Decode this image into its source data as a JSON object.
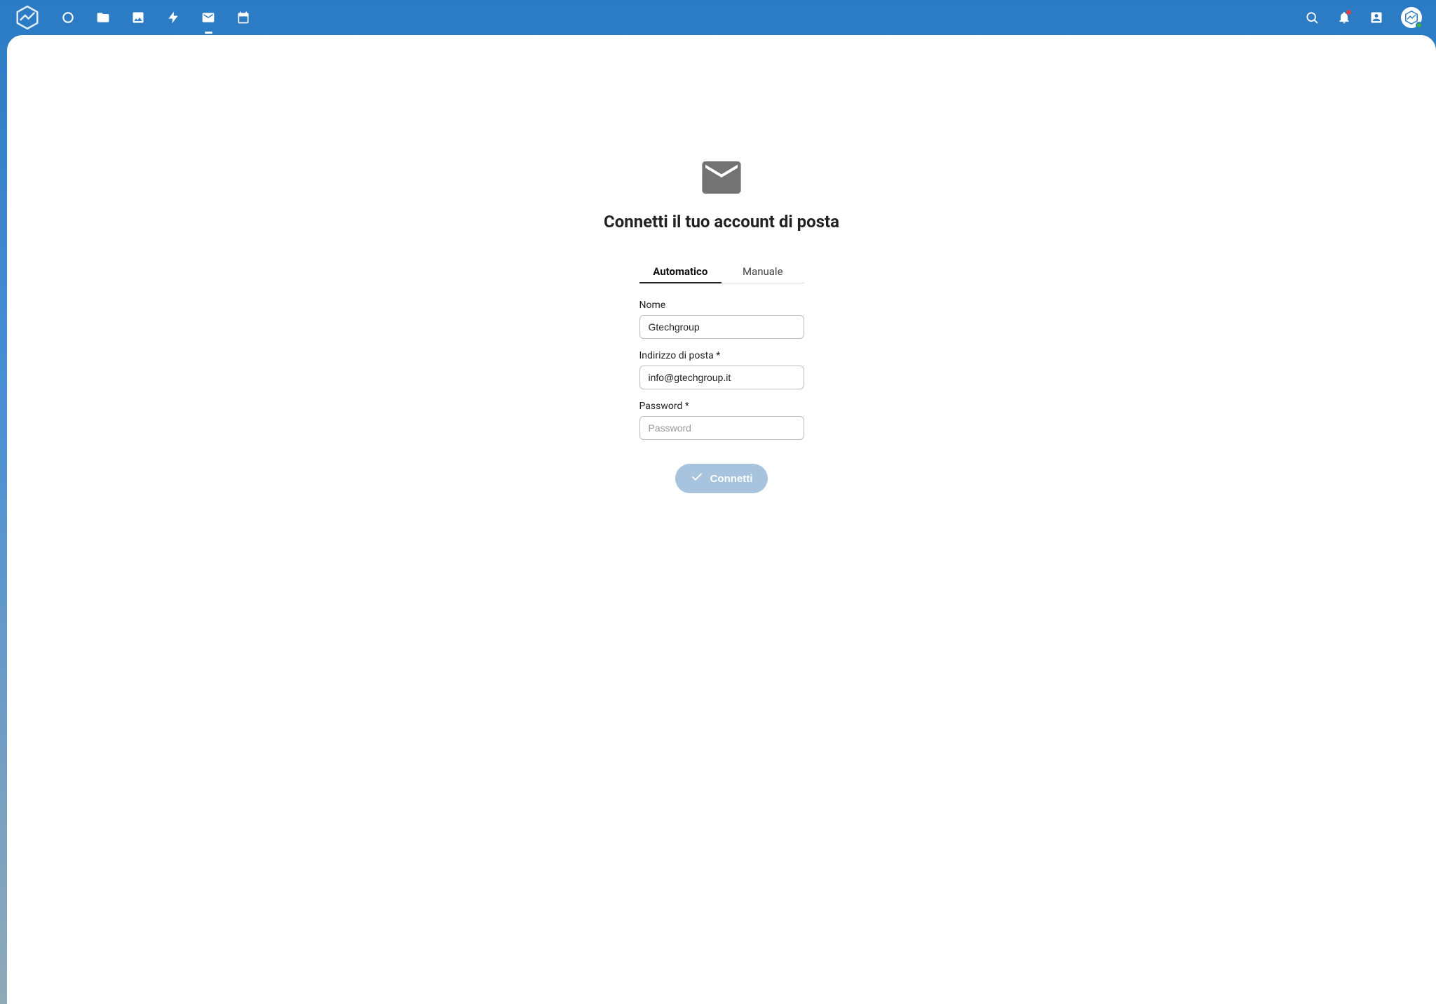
{
  "topbar": {
    "nav_items": [
      {
        "name": "dashboard",
        "icon": "circle"
      },
      {
        "name": "files",
        "icon": "folder"
      },
      {
        "name": "photos",
        "icon": "image"
      },
      {
        "name": "activity",
        "icon": "bolt"
      },
      {
        "name": "mail",
        "icon": "mail",
        "active": true
      },
      {
        "name": "calendar",
        "icon": "calendar"
      }
    ],
    "right_items": [
      {
        "name": "search",
        "icon": "search"
      },
      {
        "name": "notifications",
        "icon": "bell",
        "badge": true
      },
      {
        "name": "contacts",
        "icon": "contacts"
      },
      {
        "name": "profile",
        "icon": "avatar",
        "status": "online"
      }
    ]
  },
  "main": {
    "headline": "Connetti il tuo account di posta",
    "tabs": {
      "automatic": "Automatico",
      "manual": "Manuale",
      "active": "automatic"
    },
    "fields": {
      "name_label": "Nome",
      "name_value": "Gtechgroup",
      "email_label": "Indirizzo di posta *",
      "email_value": "info@gtechgroup.it",
      "password_label": "Password *",
      "password_placeholder": "Password",
      "password_value": ""
    },
    "connect_label": "Connetti"
  }
}
